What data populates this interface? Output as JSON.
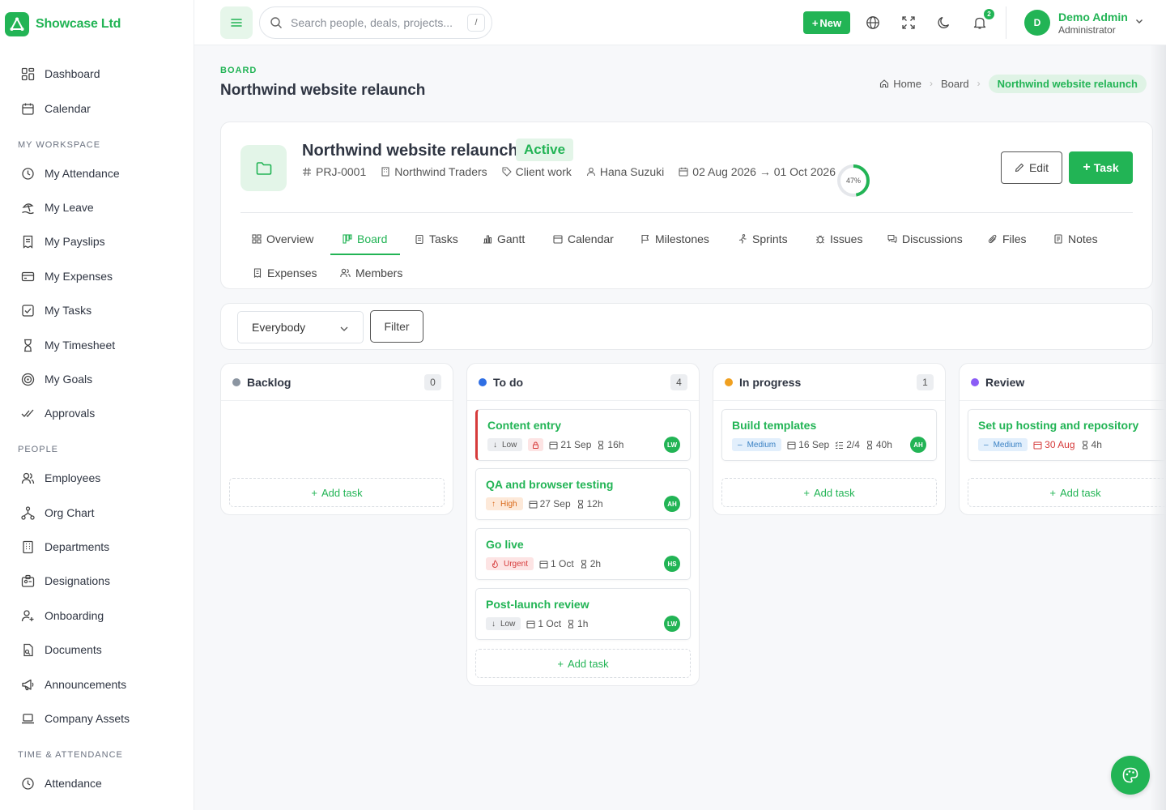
{
  "brand": {
    "name": "Showcase Ltd"
  },
  "sidebar": {
    "top_items": [
      {
        "label": "Dashboard",
        "icon": "dashboard-icon"
      },
      {
        "label": "Calendar",
        "icon": "calendar-icon"
      }
    ],
    "sections": [
      {
        "title": "MY WORKSPACE",
        "items": [
          {
            "label": "My Attendance",
            "icon": "clock-icon"
          },
          {
            "label": "My Leave",
            "icon": "beach-icon"
          },
          {
            "label": "My Payslips",
            "icon": "receipt-icon"
          },
          {
            "label": "My Expenses",
            "icon": "credit-card-icon"
          },
          {
            "label": "My Tasks",
            "icon": "checkbox-icon"
          },
          {
            "label": "My Timesheet",
            "icon": "hourglass-icon"
          },
          {
            "label": "My Goals",
            "icon": "target-icon"
          },
          {
            "label": "Approvals",
            "icon": "double-check-icon"
          }
        ]
      },
      {
        "title": "PEOPLE",
        "items": [
          {
            "label": "Employees",
            "icon": "users-icon"
          },
          {
            "label": "Org Chart",
            "icon": "hierarchy-icon"
          },
          {
            "label": "Departments",
            "icon": "building-icon"
          },
          {
            "label": "Designations",
            "icon": "id-badge-icon"
          },
          {
            "label": "Onboarding",
            "icon": "user-plus-icon"
          },
          {
            "label": "Documents",
            "icon": "document-icon"
          },
          {
            "label": "Announcements",
            "icon": "megaphone-icon"
          },
          {
            "label": "Company Assets",
            "icon": "laptop-icon"
          }
        ]
      },
      {
        "title": "TIME & ATTENDANCE",
        "items": [
          {
            "label": "Attendance",
            "icon": "clock-icon"
          }
        ]
      }
    ]
  },
  "topbar": {
    "search_placeholder": "Search people, deals, projects...",
    "search_shortcut": "/",
    "new_label": "New",
    "notification_count": "2",
    "user_initial": "D",
    "user_name": "Demo Admin",
    "user_role": "Administrator"
  },
  "page": {
    "eyebrow": "BOARD",
    "title": "Northwind website relaunch",
    "breadcrumb": {
      "home": "Home",
      "section": "Board",
      "current": "Northwind website relaunch"
    }
  },
  "project": {
    "name": "Northwind website relaunch",
    "status": "Active",
    "code": "PRJ-0001",
    "client": "Northwind Traders",
    "category": "Client work",
    "owner": "Hana Suzuki",
    "dates": "02 Aug 2026 → 01 Oct 2026",
    "progress": 47,
    "progress_label": "47%",
    "edit_label": "Edit",
    "task_label": "Task"
  },
  "tabs": [
    {
      "label": "Overview",
      "icon": "grid-icon"
    },
    {
      "label": "Board",
      "icon": "board-icon",
      "active": true
    },
    {
      "label": "Tasks",
      "icon": "clipboard-icon"
    },
    {
      "label": "Gantt",
      "icon": "gantt-icon"
    },
    {
      "label": "Calendar",
      "icon": "calendar-icon"
    },
    {
      "label": "Milestones",
      "icon": "flag-icon"
    },
    {
      "label": "Sprints",
      "icon": "runner-icon"
    },
    {
      "label": "Issues",
      "icon": "bug-icon"
    },
    {
      "label": "Discussions",
      "icon": "chat-icon"
    },
    {
      "label": "Files",
      "icon": "paperclip-icon"
    },
    {
      "label": "Notes",
      "icon": "note-icon"
    },
    {
      "label": "Expenses",
      "icon": "receipt-icon"
    },
    {
      "label": "Members",
      "icon": "users-icon"
    }
  ],
  "filter": {
    "select_value": "Everybody",
    "button_label": "Filter"
  },
  "columns": [
    {
      "title": "Backlog",
      "count": "0",
      "color": "#8b95a1",
      "add_label": "Add task",
      "tasks": []
    },
    {
      "title": "To do",
      "count": "4",
      "color": "#2f6fe4",
      "add_label": "Add task",
      "tasks": [
        {
          "title": "Content entry",
          "priority": "Low",
          "locked": true,
          "date": "21 Sep",
          "hours": "16h",
          "assignee": "LW",
          "flagged": true
        },
        {
          "title": "QA and browser testing",
          "priority": "High",
          "date": "27 Sep",
          "hours": "12h",
          "assignee": "AH"
        },
        {
          "title": "Go live",
          "priority": "Urgent",
          "date": "1 Oct",
          "hours": "2h",
          "assignee": "HS"
        },
        {
          "title": "Post-launch review",
          "priority": "Low",
          "date": "1 Oct",
          "hours": "1h",
          "assignee": "LW"
        }
      ]
    },
    {
      "title": "In progress",
      "count": "1",
      "color": "#f0a020",
      "add_label": "Add task",
      "tasks": [
        {
          "title": "Build templates",
          "priority": "Medium",
          "date": "16 Sep",
          "subtasks": "2/4",
          "hours": "40h",
          "assignee": "AH"
        }
      ]
    },
    {
      "title": "Review",
      "count": "",
      "color": "#8b5cf6",
      "add_label": "Add task",
      "tasks": [
        {
          "title": "Set up hosting and repository",
          "priority": "Medium",
          "date": "30 Aug",
          "overdue": true,
          "hours": "4h"
        }
      ]
    }
  ],
  "colors": {
    "accent": "#22b455",
    "danger": "#d63b3b"
  }
}
